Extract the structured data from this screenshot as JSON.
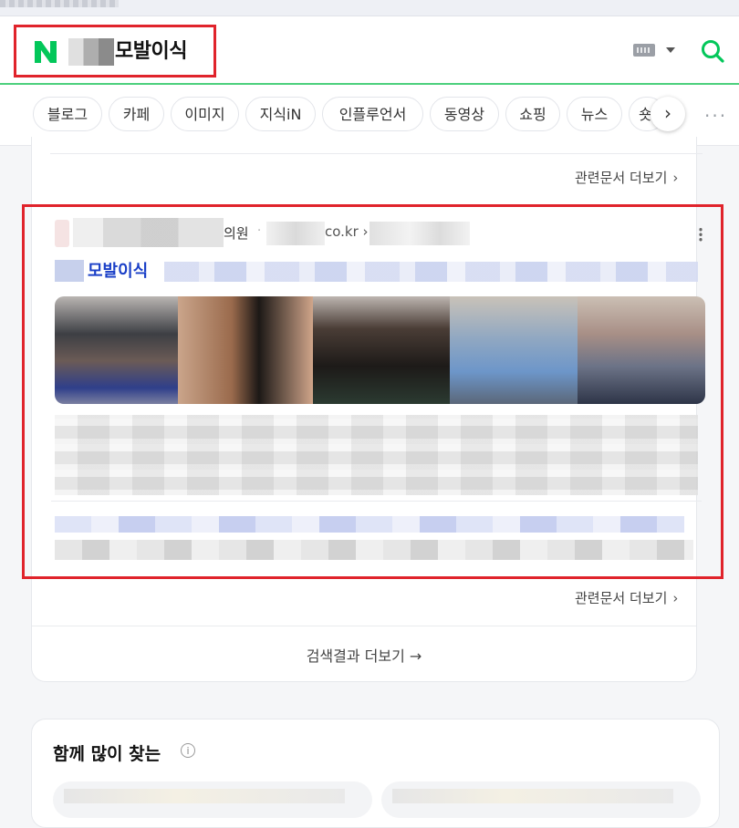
{
  "header": {
    "logo_letter": "N",
    "query": "모발이식"
  },
  "tabs": [
    {
      "label": "블로그"
    },
    {
      "label": "카페"
    },
    {
      "label": "이미지"
    },
    {
      "label": "지식iN"
    },
    {
      "label": "인플루언서"
    },
    {
      "label": "동영상"
    },
    {
      "label": "쇼핑"
    },
    {
      "label": "뉴스"
    },
    {
      "label": "숏"
    }
  ],
  "tabs_next_arrow": "›",
  "tabs_more": "···",
  "card": {
    "more_docs_label": "관련문서 더보기",
    "result": {
      "site_name": "의원",
      "url_domain": "co.kr ›",
      "title_keyword": "모발이식"
    },
    "see_all_label": "검색결과 더보기 →"
  },
  "related": {
    "heading": "함께 많이 찾는",
    "info_glyph": "i"
  },
  "colors": {
    "naver_green": "#03c75a",
    "highlight_red": "#e0232b",
    "link_blue": "#1a3fc7"
  }
}
